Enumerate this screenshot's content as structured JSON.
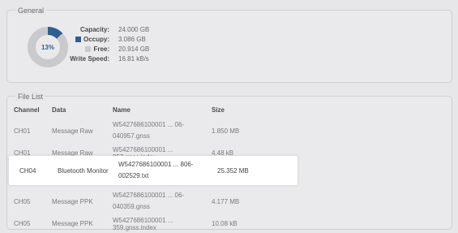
{
  "general": {
    "title": "General",
    "donut_percent_label": "13%",
    "used_fraction": 0.13,
    "colors": {
      "occupy": "#2f5e93",
      "free": "#cacacc"
    },
    "capacity_label": "Capacity:",
    "capacity_value": "24.000 GB",
    "occupy_label": "Occupy:",
    "occupy_value": "3.086 GB",
    "free_label": "Free:",
    "free_value": "20.914 GB",
    "write_speed_label": "Write Speed:",
    "write_speed_value": "16.81 kB/s"
  },
  "file_list": {
    "title": "File List",
    "headers": {
      "channel": "Channel",
      "data": "Data",
      "name": "Name",
      "size": "Size"
    },
    "rows": [
      {
        "channel": "CH01",
        "data": "Message Raw",
        "name_line1": "W5427686100001 ... 06-",
        "name_line2": "040957.gnss",
        "size": "1.850 MB"
      },
      {
        "channel": "CH01",
        "data": "Message Raw",
        "name_line1": "W5427686100001 ... 957.gnss.index",
        "name_line2": "",
        "size": "4.48 kB"
      },
      {
        "channel": "CH04",
        "data": "Bluetooth Monitor",
        "name_line1": "W5427686100001 ... 806-",
        "name_line2": "002529.txt",
        "size": "25.352 MB"
      },
      {
        "channel": "CH05",
        "data": "Message PPK",
        "name_line1": "W5427686100001 ... 06-",
        "name_line2": "040359.gnss",
        "size": "4.177 MB"
      },
      {
        "channel": "CH05",
        "data": "Message PPK",
        "name_line1": "W5427686100001 ... 359.gnss.index",
        "name_line2": "",
        "size": "10.08 kB"
      }
    ]
  }
}
